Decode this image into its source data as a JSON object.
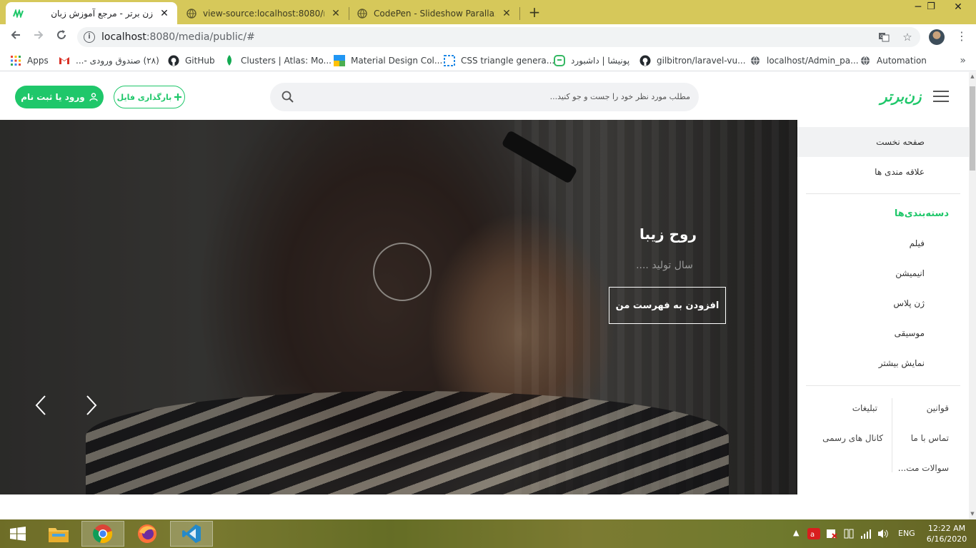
{
  "browser": {
    "tabs": [
      {
        "title": "زن برتر - مرجع آموزش زبان",
        "close": "✕"
      },
      {
        "title": "view-source:localhost:8080/medi",
        "close": "✕"
      },
      {
        "title": "CodePen - Slideshow Parallax wit",
        "close": "✕"
      }
    ],
    "new_tab": "+",
    "window_controls": {
      "minimize": "─",
      "maximize": "❐",
      "close": "✕"
    },
    "url_host": "localhost",
    "url_rest": ":8080/media/public/#",
    "bookmarks": [
      "Apps",
      "(۲۸) صندوق ورودی -...",
      "GitHub",
      "Clusters | Atlas: Mo...",
      "Material Design Col...",
      "CSS triangle genera...",
      "پونیشا | داشبورد",
      "gilbitron/laravel-vu...",
      "localhost/Admin_pa...",
      "Automation"
    ],
    "bookmarks_more": "»"
  },
  "header": {
    "login_label": "ورود یا ثبت نام",
    "upload_label": "بارگذاری فایل",
    "search_placeholder": "مطلب مورد نظر خود را جست و جو کنید...",
    "logo_text": "زن‌برتر"
  },
  "hero": {
    "title": "روح زیبا",
    "subtitle": "سال تولید ....",
    "button_label": "افزودن به فهرست من"
  },
  "sidebar": {
    "home": "صفحه نخست",
    "favorites": "علاقه مندی ها",
    "categories_title": "دسته‌بندی‌ها",
    "categories": [
      "فیلم",
      "انیمیشن",
      "ژن پلاس",
      "موسیقی",
      "نمایش بیشتر"
    ],
    "footer_links": {
      "rules": "قوانین",
      "ads": "تبلیغات",
      "contact": "تماس با ما",
      "channels": "کانال های رسمی",
      "faq": "سوالات مت..."
    }
  },
  "taskbar": {
    "lang": "ENG",
    "time": "12:22 AM",
    "date": "6/16/2020"
  },
  "colors": {
    "brand_green": "#1fc76a",
    "tabstrip": "#d6c85a"
  }
}
